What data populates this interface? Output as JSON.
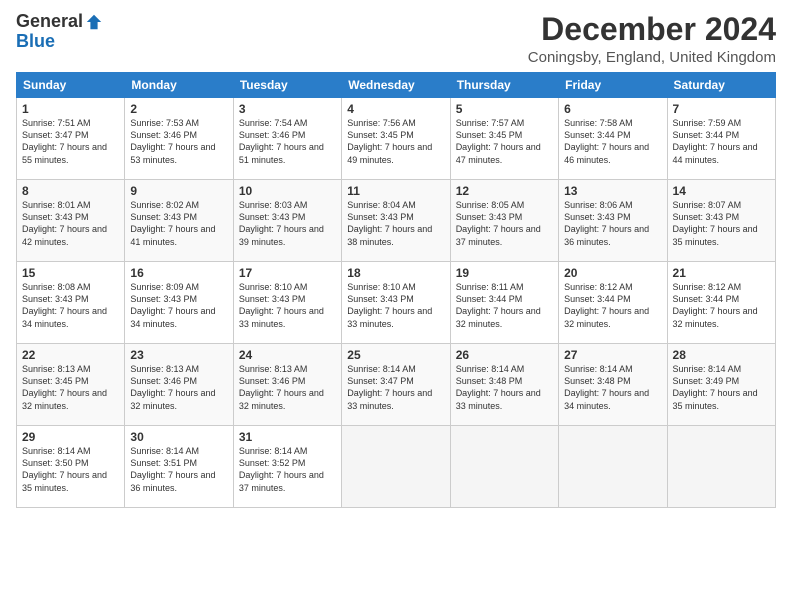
{
  "logo": {
    "general": "General",
    "blue": "Blue"
  },
  "title": "December 2024",
  "subtitle": "Coningsby, England, United Kingdom",
  "headers": [
    "Sunday",
    "Monday",
    "Tuesday",
    "Wednesday",
    "Thursday",
    "Friday",
    "Saturday"
  ],
  "weeks": [
    [
      {
        "day": "1",
        "sunrise": "Sunrise: 7:51 AM",
        "sunset": "Sunset: 3:47 PM",
        "daylight": "Daylight: 7 hours and 55 minutes."
      },
      {
        "day": "2",
        "sunrise": "Sunrise: 7:53 AM",
        "sunset": "Sunset: 3:46 PM",
        "daylight": "Daylight: 7 hours and 53 minutes."
      },
      {
        "day": "3",
        "sunrise": "Sunrise: 7:54 AM",
        "sunset": "Sunset: 3:46 PM",
        "daylight": "Daylight: 7 hours and 51 minutes."
      },
      {
        "day": "4",
        "sunrise": "Sunrise: 7:56 AM",
        "sunset": "Sunset: 3:45 PM",
        "daylight": "Daylight: 7 hours and 49 minutes."
      },
      {
        "day": "5",
        "sunrise": "Sunrise: 7:57 AM",
        "sunset": "Sunset: 3:45 PM",
        "daylight": "Daylight: 7 hours and 47 minutes."
      },
      {
        "day": "6",
        "sunrise": "Sunrise: 7:58 AM",
        "sunset": "Sunset: 3:44 PM",
        "daylight": "Daylight: 7 hours and 46 minutes."
      },
      {
        "day": "7",
        "sunrise": "Sunrise: 7:59 AM",
        "sunset": "Sunset: 3:44 PM",
        "daylight": "Daylight: 7 hours and 44 minutes."
      }
    ],
    [
      {
        "day": "8",
        "sunrise": "Sunrise: 8:01 AM",
        "sunset": "Sunset: 3:43 PM",
        "daylight": "Daylight: 7 hours and 42 minutes."
      },
      {
        "day": "9",
        "sunrise": "Sunrise: 8:02 AM",
        "sunset": "Sunset: 3:43 PM",
        "daylight": "Daylight: 7 hours and 41 minutes."
      },
      {
        "day": "10",
        "sunrise": "Sunrise: 8:03 AM",
        "sunset": "Sunset: 3:43 PM",
        "daylight": "Daylight: 7 hours and 39 minutes."
      },
      {
        "day": "11",
        "sunrise": "Sunrise: 8:04 AM",
        "sunset": "Sunset: 3:43 PM",
        "daylight": "Daylight: 7 hours and 38 minutes."
      },
      {
        "day": "12",
        "sunrise": "Sunrise: 8:05 AM",
        "sunset": "Sunset: 3:43 PM",
        "daylight": "Daylight: 7 hours and 37 minutes."
      },
      {
        "day": "13",
        "sunrise": "Sunrise: 8:06 AM",
        "sunset": "Sunset: 3:43 PM",
        "daylight": "Daylight: 7 hours and 36 minutes."
      },
      {
        "day": "14",
        "sunrise": "Sunrise: 8:07 AM",
        "sunset": "Sunset: 3:43 PM",
        "daylight": "Daylight: 7 hours and 35 minutes."
      }
    ],
    [
      {
        "day": "15",
        "sunrise": "Sunrise: 8:08 AM",
        "sunset": "Sunset: 3:43 PM",
        "daylight": "Daylight: 7 hours and 34 minutes."
      },
      {
        "day": "16",
        "sunrise": "Sunrise: 8:09 AM",
        "sunset": "Sunset: 3:43 PM",
        "daylight": "Daylight: 7 hours and 34 minutes."
      },
      {
        "day": "17",
        "sunrise": "Sunrise: 8:10 AM",
        "sunset": "Sunset: 3:43 PM",
        "daylight": "Daylight: 7 hours and 33 minutes."
      },
      {
        "day": "18",
        "sunrise": "Sunrise: 8:10 AM",
        "sunset": "Sunset: 3:43 PM",
        "daylight": "Daylight: 7 hours and 33 minutes."
      },
      {
        "day": "19",
        "sunrise": "Sunrise: 8:11 AM",
        "sunset": "Sunset: 3:44 PM",
        "daylight": "Daylight: 7 hours and 32 minutes."
      },
      {
        "day": "20",
        "sunrise": "Sunrise: 8:12 AM",
        "sunset": "Sunset: 3:44 PM",
        "daylight": "Daylight: 7 hours and 32 minutes."
      },
      {
        "day": "21",
        "sunrise": "Sunrise: 8:12 AM",
        "sunset": "Sunset: 3:44 PM",
        "daylight": "Daylight: 7 hours and 32 minutes."
      }
    ],
    [
      {
        "day": "22",
        "sunrise": "Sunrise: 8:13 AM",
        "sunset": "Sunset: 3:45 PM",
        "daylight": "Daylight: 7 hours and 32 minutes."
      },
      {
        "day": "23",
        "sunrise": "Sunrise: 8:13 AM",
        "sunset": "Sunset: 3:46 PM",
        "daylight": "Daylight: 7 hours and 32 minutes."
      },
      {
        "day": "24",
        "sunrise": "Sunrise: 8:13 AM",
        "sunset": "Sunset: 3:46 PM",
        "daylight": "Daylight: 7 hours and 32 minutes."
      },
      {
        "day": "25",
        "sunrise": "Sunrise: 8:14 AM",
        "sunset": "Sunset: 3:47 PM",
        "daylight": "Daylight: 7 hours and 33 minutes."
      },
      {
        "day": "26",
        "sunrise": "Sunrise: 8:14 AM",
        "sunset": "Sunset: 3:48 PM",
        "daylight": "Daylight: 7 hours and 33 minutes."
      },
      {
        "day": "27",
        "sunrise": "Sunrise: 8:14 AM",
        "sunset": "Sunset: 3:48 PM",
        "daylight": "Daylight: 7 hours and 34 minutes."
      },
      {
        "day": "28",
        "sunrise": "Sunrise: 8:14 AM",
        "sunset": "Sunset: 3:49 PM",
        "daylight": "Daylight: 7 hours and 35 minutes."
      }
    ],
    [
      {
        "day": "29",
        "sunrise": "Sunrise: 8:14 AM",
        "sunset": "Sunset: 3:50 PM",
        "daylight": "Daylight: 7 hours and 35 minutes."
      },
      {
        "day": "30",
        "sunrise": "Sunrise: 8:14 AM",
        "sunset": "Sunset: 3:51 PM",
        "daylight": "Daylight: 7 hours and 36 minutes."
      },
      {
        "day": "31",
        "sunrise": "Sunrise: 8:14 AM",
        "sunset": "Sunset: 3:52 PM",
        "daylight": "Daylight: 7 hours and 37 minutes."
      },
      null,
      null,
      null,
      null
    ]
  ]
}
